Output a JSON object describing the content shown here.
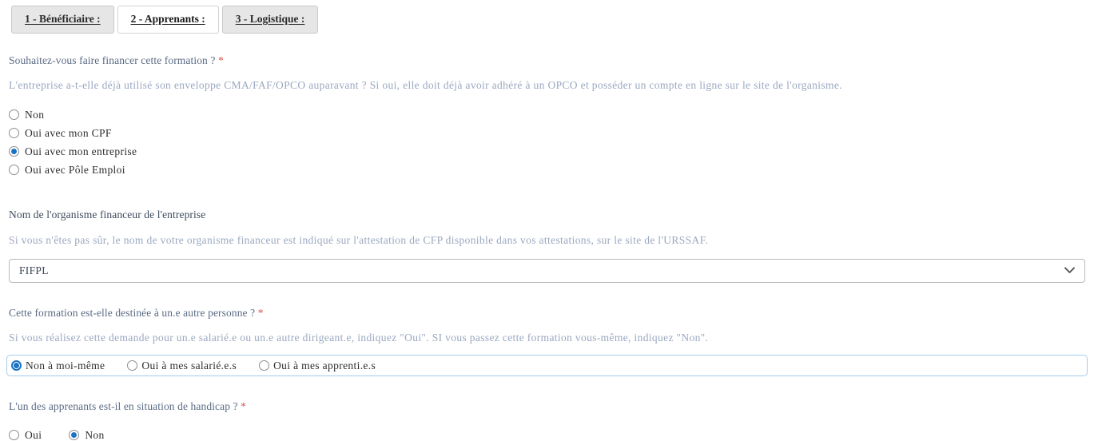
{
  "tabs": [
    {
      "label": "1 - Bénéficiaire :",
      "active": false
    },
    {
      "label": "2 - Apprenants :",
      "active": true
    },
    {
      "label": "3 - Logistique :",
      "active": false
    }
  ],
  "colors": {
    "accent": "#1a73c4",
    "required": "#d9534f",
    "label": "#5b6b84",
    "help": "#9aa8c0",
    "focus_border": "#a8cdea",
    "tab_inactive_bg": "#e6e6e6",
    "tab_active_bg": "#ffffff"
  },
  "questions": {
    "financing": {
      "label": "Souhaitez-vous faire financer cette formation ?",
      "required_mark": "*",
      "help": "L'entreprise a-t-elle déjà utilisé son enveloppe CMA/FAF/OPCO auparavant ? Si oui, elle doit déjà avoir adhéré à un OPCO et posséder un compte en ligne sur le site de l'organisme.",
      "options": [
        {
          "label": "Non",
          "checked": false
        },
        {
          "label": "Oui avec mon CPF",
          "checked": false
        },
        {
          "label": "Oui avec mon entreprise",
          "checked": true
        },
        {
          "label": "Oui avec Pôle Emploi",
          "checked": false
        }
      ]
    },
    "funder": {
      "label": "Nom de l'organisme financeur de l'entreprise",
      "help": "Si vous n'êtes pas sûr, le nom de votre organisme financeur est indiqué sur l'attestation de CFP disponible dans vos attestations, sur le site de l'URSSAF.",
      "selected_value": "FIFPL",
      "dropdown_icon": "chevron-down-icon"
    },
    "other_person": {
      "label": "Cette formation est-elle destinée à un.e autre personne ?",
      "required_mark": "*",
      "help": "Si vous réalisez cette demande pour un.e salarié.e ou un.e autre dirigeant.e, indiquez \"Oui\". SI vous passez cette formation vous-même, indiquez \"Non\".",
      "focused": true,
      "options": [
        {
          "label": "Non à moi-même",
          "checked": true
        },
        {
          "label": "Oui à mes salarié.e.s",
          "checked": false
        },
        {
          "label": "Oui à mes apprenti.e.s",
          "checked": false
        }
      ]
    },
    "handicap": {
      "label": "L'un des apprenants est-il en situation de handicap ?",
      "required_mark": "*",
      "options": [
        {
          "label": "Oui",
          "checked": false
        },
        {
          "label": "Non",
          "checked": true
        }
      ]
    }
  }
}
